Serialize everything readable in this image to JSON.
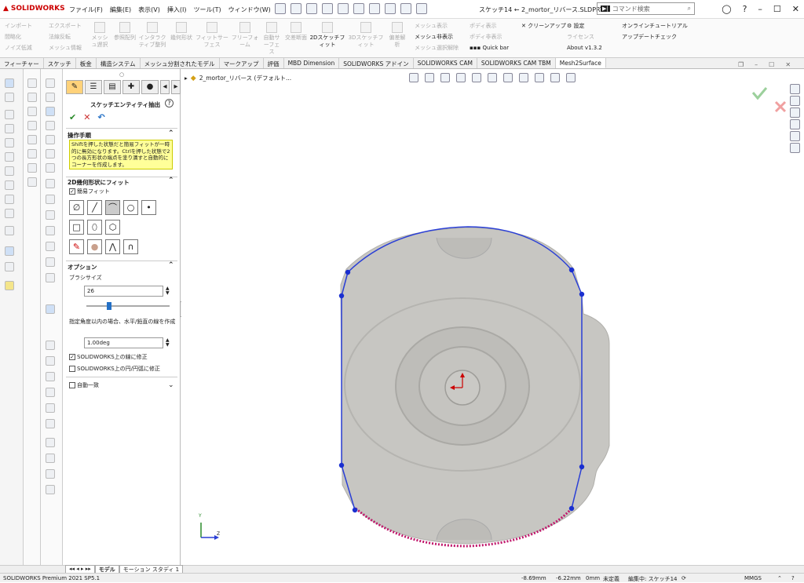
{
  "app": {
    "brand": "SOLIDWORKS"
  },
  "menu": [
    "ファイル(F)",
    "編集(E)",
    "表示(V)",
    "挿入(I)",
    "ツール(T)",
    "ウィンドウ(W)"
  ],
  "doc_title": "スケッチ14 ← 2_mortor_リバース.SLDPRT *",
  "search": {
    "prefix": "▶|",
    "placeholder": "コマンド検索"
  },
  "ribbon": {
    "col1": [
      "インポート",
      "間略化",
      "ノイズ低減"
    ],
    "col2": [
      "エクスポート",
      "法線反転",
      "メッシュ情報"
    ],
    "big": [
      "メッシュ遅択",
      "参照配列",
      "インタラクティブ整列",
      "幾何形状",
      "フィットサーフェス",
      "フリーフォーム",
      "自動サーフェス",
      "交差断面",
      "2Dスケッチフィット",
      "3Dスケッチフィット",
      "偏差解析"
    ],
    "col3": [
      "メッシュ表示",
      "メッシュ非表示",
      "メッシュ選択解除"
    ],
    "col4": [
      "ポディ表示",
      "ポディ非表示"
    ],
    "col5": [
      "クリーンアップ",
      "Quick bar"
    ],
    "col6": [
      "設定",
      "ライセンス",
      "About v1.3.2"
    ],
    "col7": [
      "オンラインチュートリアル",
      "アップデートチェック"
    ]
  },
  "tabs": [
    "フィーチャー",
    "スケッチ",
    "板金",
    "構造システム",
    "メッシュ分割されたモデル",
    "マークアップ",
    "評価",
    "MBD Dimension",
    "SOLIDWORKS アドイン",
    "SOLIDWORKS CAM",
    "SOLIDWORKS CAM TBM",
    "Mesh2Surface"
  ],
  "active_tab": "Mesh2Surface",
  "panel": {
    "title": "スケッチエンティティ抽出",
    "sections": {
      "procedure": "操作手順",
      "note": "Shiftを押した状態だと簡易フィットが一時的に無効になります。Ctrlを押した状態で2つの長方形状の端点を塗り潰すと自動的にコーナーを作成します。",
      "fit": "2D幾何形状にフィット",
      "simple_fit": "簡易フィット",
      "options": "オプション",
      "brush_label": "ブラシサイズ",
      "brush_value": "26",
      "brush_level": 0.27,
      "angle_label": "指定角度以内の場合、水平/鉛直の線を作成",
      "angle_value": "1.00deg",
      "fix_lines": "SOLIDWORKS上の線に修正",
      "fix_arcs": "SOLIDWORKS上の円/円弧に修正",
      "auto_match": "自動一致"
    }
  },
  "viewport": {
    "breadcrumb": "2_mortor_リバース (デフォルト..."
  },
  "axis": {
    "y": "Y",
    "z": "Z"
  },
  "bottom_tabs": [
    "モデル",
    "モーション スタディ 1"
  ],
  "status": {
    "product": "SOLIDWORKS Premium 2021 SP5.1",
    "x": "-8.69mm",
    "y": "-6.22mm",
    "z": "0mm",
    "state": "未定義",
    "editing": "編集中: スケッチ14",
    "units": "MMGS"
  },
  "colors": {
    "accent": "#2470c6",
    "sketch": "#2a3fd6",
    "mesh": "#c7c6c2"
  }
}
